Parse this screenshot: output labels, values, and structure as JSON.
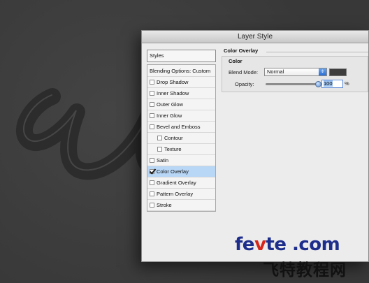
{
  "dialog": {
    "title": "Layer Style",
    "styles_header": "Styles",
    "items": [
      {
        "label": "Blending Options: Custom",
        "has_checkbox": false,
        "checked": false,
        "indent": false,
        "selected": false
      },
      {
        "label": "Drop Shadow",
        "has_checkbox": true,
        "checked": false,
        "indent": false,
        "selected": false
      },
      {
        "label": "Inner Shadow",
        "has_checkbox": true,
        "checked": false,
        "indent": false,
        "selected": false
      },
      {
        "label": "Outer Glow",
        "has_checkbox": true,
        "checked": false,
        "indent": false,
        "selected": false
      },
      {
        "label": "Inner Glow",
        "has_checkbox": true,
        "checked": false,
        "indent": false,
        "selected": false
      },
      {
        "label": "Bevel and Emboss",
        "has_checkbox": true,
        "checked": false,
        "indent": false,
        "selected": false
      },
      {
        "label": "Contour",
        "has_checkbox": true,
        "checked": false,
        "indent": true,
        "selected": false
      },
      {
        "label": "Texture",
        "has_checkbox": true,
        "checked": false,
        "indent": true,
        "selected": false
      },
      {
        "label": "Satin",
        "has_checkbox": true,
        "checked": false,
        "indent": false,
        "selected": false
      },
      {
        "label": "Color Overlay",
        "has_checkbox": true,
        "checked": true,
        "indent": false,
        "selected": true
      },
      {
        "label": "Gradient Overlay",
        "has_checkbox": true,
        "checked": false,
        "indent": false,
        "selected": false
      },
      {
        "label": "Pattern Overlay",
        "has_checkbox": true,
        "checked": false,
        "indent": false,
        "selected": false
      },
      {
        "label": "Stroke",
        "has_checkbox": true,
        "checked": false,
        "indent": false,
        "selected": false
      }
    ],
    "panel": {
      "group_title": "Color Overlay",
      "sub_title": "Color",
      "blend_mode_label": "Blend Mode:",
      "blend_mode_value": "Normal",
      "overlay_color": "#3d3d3d",
      "opacity_label": "Opacity:",
      "opacity_value": "100",
      "opacity_unit": "%"
    }
  },
  "watermark": {
    "line1_a": "fe",
    "line1_b": "v",
    "line1_c": "te .com",
    "line2": "飞特教程网"
  }
}
